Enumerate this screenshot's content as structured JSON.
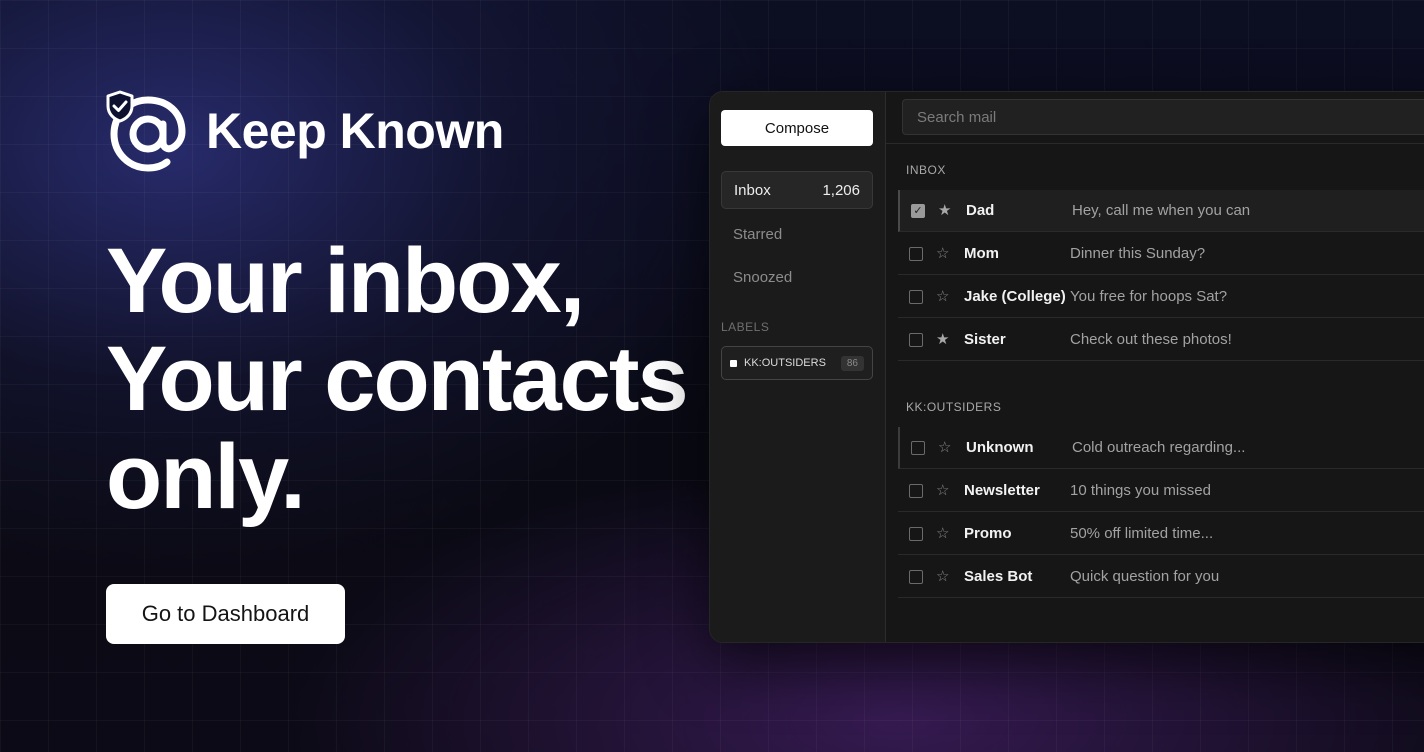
{
  "brand": {
    "name": "Keep Known",
    "logo_icon": "shield-at-icon"
  },
  "hero": {
    "line1": "Your inbox,",
    "line2": "Your contacts",
    "line3": "only."
  },
  "cta": {
    "label": "Go to Dashboard"
  },
  "app": {
    "sidebar": {
      "compose_label": "Compose",
      "nav": [
        {
          "label": "Inbox",
          "count": "1,206",
          "active": true
        },
        {
          "label": "Starred",
          "count": "",
          "active": false
        },
        {
          "label": "Snoozed",
          "count": "",
          "active": false
        }
      ],
      "labels_title": "LABELS",
      "labels": [
        {
          "label": "KK:OUTSIDERS",
          "count": "86"
        }
      ]
    },
    "search": {
      "placeholder": "Search mail",
      "value": ""
    },
    "sections": [
      {
        "title": "INBOX",
        "rows": [
          {
            "sender": "Dad",
            "snippet": "Hey, call me when you can",
            "checked": true,
            "starred": true
          },
          {
            "sender": "Mom",
            "snippet": "Dinner this Sunday?",
            "checked": false,
            "starred": false
          },
          {
            "sender": "Jake (College)",
            "snippet": "You free for hoops Sat?",
            "checked": false,
            "starred": false
          },
          {
            "sender": "Sister",
            "snippet": "Check out these photos!",
            "checked": false,
            "starred": true
          }
        ]
      },
      {
        "title": "KK:OUTSIDERS",
        "rows": [
          {
            "sender": "Unknown",
            "snippet": "Cold outreach regarding...",
            "checked": false,
            "starred": false
          },
          {
            "sender": "Newsletter",
            "snippet": "10 things you missed",
            "checked": false,
            "starred": false
          },
          {
            "sender": "Promo",
            "snippet": "50% off limited time...",
            "checked": false,
            "starred": false
          },
          {
            "sender": "Sales Bot",
            "snippet": "Quick question for you",
            "checked": false,
            "starred": false
          }
        ]
      }
    ]
  },
  "colors": {
    "background_top": "#0c0e22",
    "background_glow": "#2c3078",
    "accent_purple": "#582882",
    "panel": "#161616",
    "sidebar": "#1b1b1b",
    "button": "#ffffff"
  }
}
